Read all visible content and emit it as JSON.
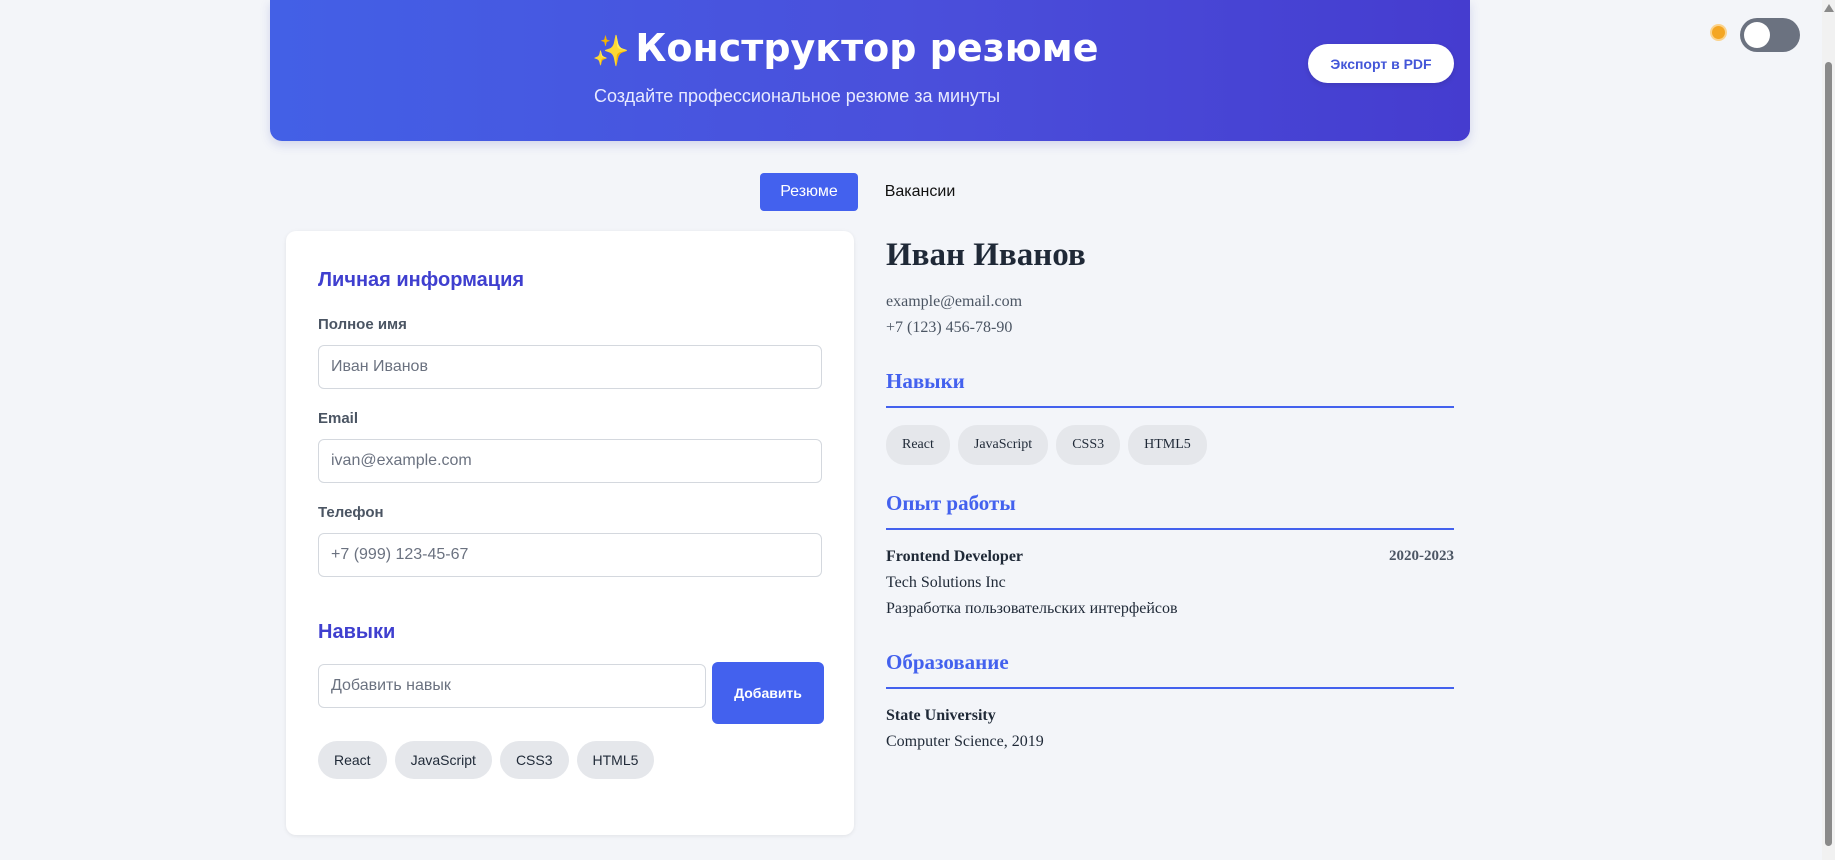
{
  "header": {
    "icon": "sparkles-icon",
    "title": "Конструктор резюме",
    "subtitle": "Создайте профессиональное резюме за минуты",
    "export_label": "Экспорт в PDF"
  },
  "theme": {
    "icon": "sun-icon",
    "dark_mode": false
  },
  "tabs": [
    {
      "label": "Резюме",
      "active": true
    },
    {
      "label": "Вакансии",
      "active": false
    }
  ],
  "form": {
    "personal_title": "Личная информация",
    "name_label": "Полное имя",
    "name_placeholder": "Иван Иванов",
    "email_label": "Email",
    "email_placeholder": "ivan@example.com",
    "phone_label": "Телефон",
    "phone_placeholder": "+7 (999) 123-45-67",
    "skills_title": "Навыки",
    "skill_placeholder": "Добавить навык",
    "add_label": "Добавить",
    "skills": [
      "React",
      "JavaScript",
      "CSS3",
      "HTML5"
    ]
  },
  "preview": {
    "name": "Иван Иванов",
    "email": "example@email.com",
    "phone": "+7 (123) 456-78-90",
    "skills_title": "Навыки",
    "skills": [
      "React",
      "JavaScript",
      "CSS3",
      "HTML5"
    ],
    "experience_title": "Опыт работы",
    "job": {
      "title": "Frontend Developer",
      "years": "2020-2023",
      "company": "Tech Solutions Inc",
      "description": "Разработка пользовательских интерфейсов"
    },
    "education_title": "Образование",
    "education": {
      "school": "State University",
      "degree": "Computer Science, 2019"
    }
  },
  "colors": {
    "accent": "#4361ee",
    "header_start": "#4360e6",
    "header_end": "#453ccf"
  }
}
